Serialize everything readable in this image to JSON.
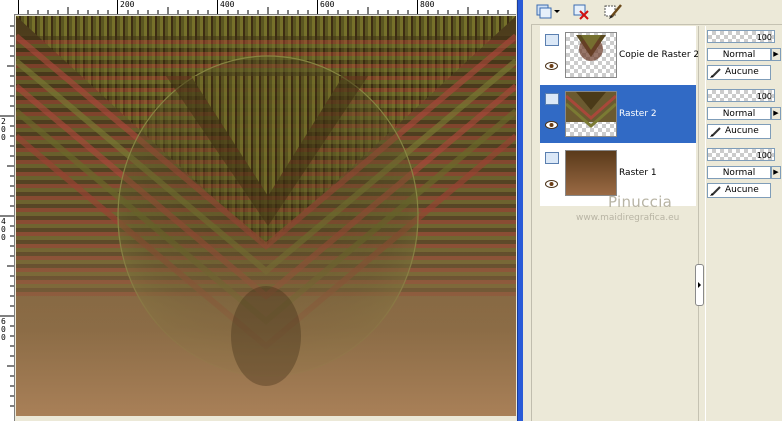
{
  "ruler": {
    "top_labels": [
      "200",
      "400",
      "600",
      "800"
    ],
    "left_labels": [
      "2\n0\n0",
      "4\n0\n0",
      "6\n0\n0"
    ]
  },
  "layers": [
    {
      "name": "Copie de Raster 2",
      "selected": false,
      "opacity": "100",
      "blend": "Normal",
      "mask": "Aucune"
    },
    {
      "name": "Raster 2",
      "selected": true,
      "opacity": "100",
      "blend": "Normal",
      "mask": "Aucune"
    },
    {
      "name": "Raster 1",
      "selected": false,
      "opacity": "100",
      "blend": "Normal",
      "mask": "Aucune"
    }
  ],
  "watermark": {
    "line1": "Pinuccia",
    "line2": "www.maidiregrafica.eu"
  },
  "icons": [
    "new-layer-icon",
    "dropdown-arrow-icon",
    "delete-layer-icon",
    "edit-icon",
    "eye-icon",
    "layer-group-icon",
    "pen-icon"
  ],
  "colors": {
    "selection": "#316ac5",
    "splitter": "#2a5bd7",
    "panel_bg": "#ece9d8"
  }
}
